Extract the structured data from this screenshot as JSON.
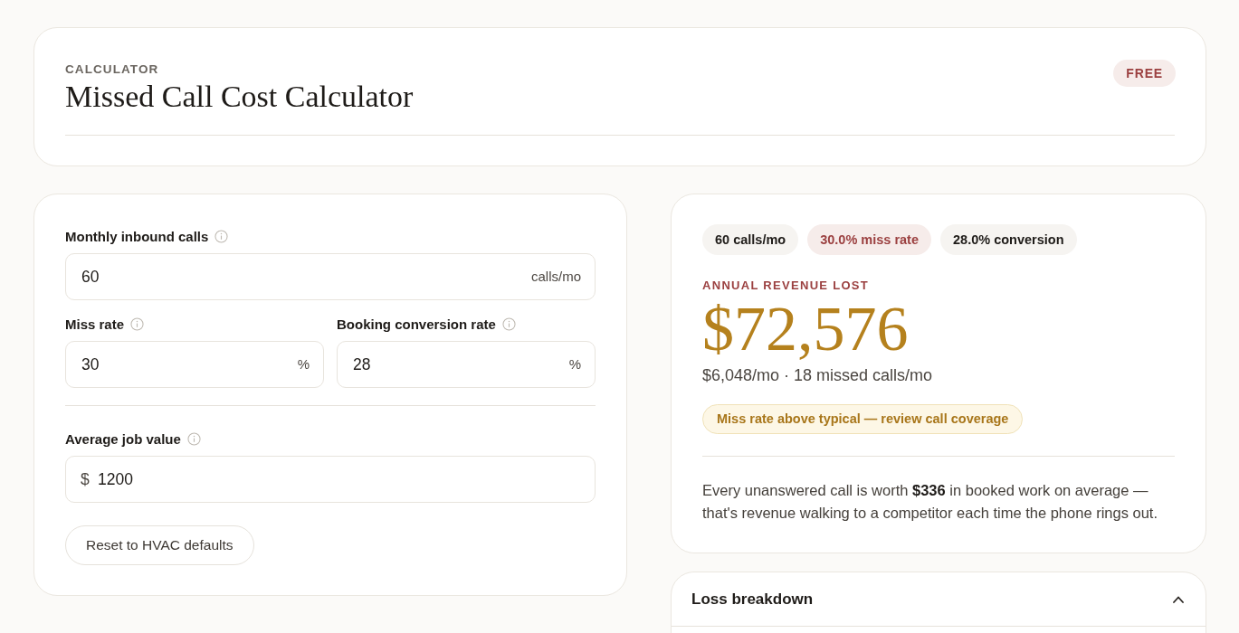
{
  "header": {
    "eyebrow": "CALCULATOR",
    "title": "Missed Call Cost Calculator",
    "badge": "FREE"
  },
  "form": {
    "groups": [
      {
        "rows": [
          [
            {
              "label": "Monthly inbound calls",
              "value": "60",
              "suffix": "calls/mo"
            }
          ],
          [
            {
              "label": "Miss rate",
              "value": "30",
              "suffix": "%"
            },
            {
              "label": "Booking conversion rate",
              "value": "28",
              "suffix": "%"
            }
          ]
        ]
      },
      {
        "rows": [
          [
            {
              "label": "Average job value",
              "value": "1200",
              "prefix": "$"
            }
          ]
        ]
      }
    ],
    "reset_button": "Reset to HVAC defaults"
  },
  "summary": {
    "chips": [
      {
        "text": "60 calls/mo",
        "kind": "neutral"
      },
      {
        "text": "30.0% miss rate",
        "kind": "alert"
      },
      {
        "text": "28.0% conversion",
        "kind": "neutral"
      }
    ],
    "label": "ANNUAL REVENUE LOST",
    "amount": "$72,576",
    "detail": "$6,048/mo · 18 missed calls/mo",
    "warning": "Miss rate above typical — review call coverage",
    "note": "Every unanswered call is worth **$336** in booked work on average — that's revenue walking to a competitor each time the phone rings out."
  },
  "breakdown": {
    "title": "Loss breakdown",
    "expanded": true
  }
}
